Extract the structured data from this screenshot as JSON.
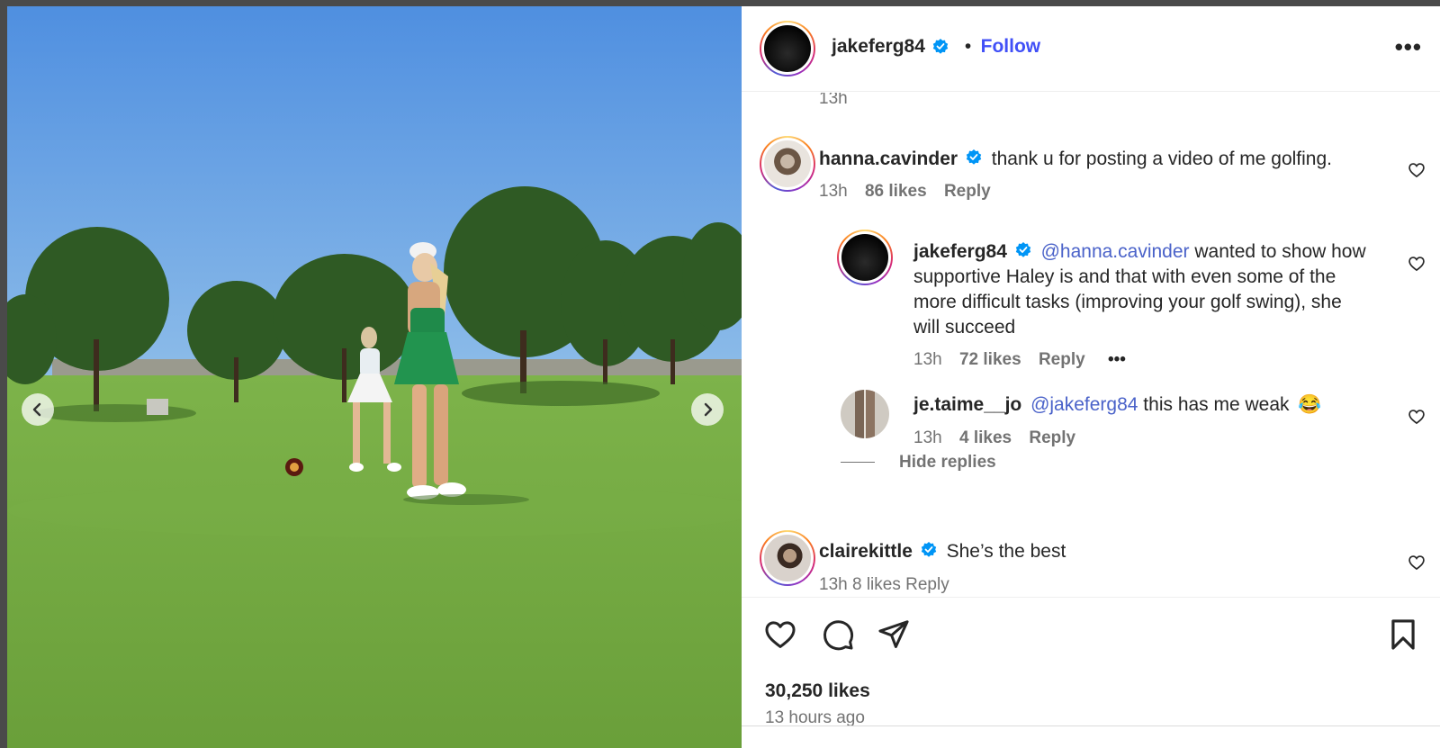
{
  "post": {
    "username": "jakeferg84",
    "follow_label": "Follow",
    "separator": "•",
    "more_label": "•••",
    "top_timestamp": "13h",
    "likes": "30,250 likes",
    "posted_ago": "13 hours ago"
  },
  "comments": [
    {
      "username": "hanna.cavinder",
      "text": "thank u for posting a video of me golfing.",
      "time": "13h",
      "likes": "86 likes",
      "reply_label": "Reply"
    },
    {
      "username": "jakeferg84",
      "mention": "@hanna.cavinder",
      "text_line1": " wanted to show how",
      "text_line2": "supportive Haley is and that with even some of the",
      "text_line3": "more difficult tasks (improving your golf swing), she",
      "text_line4": "will succeed",
      "time": "13h",
      "likes": "72 likes",
      "reply_label": "Reply",
      "more_label": "•••"
    },
    {
      "username": "je.taime__jo",
      "mention": "@jakeferg84",
      "text": " this has me weak",
      "emoji": "😂",
      "time": "13h",
      "likes": "4 likes",
      "reply_label": "Reply"
    },
    {
      "username": "clairekittle",
      "text": "She’s the best",
      "meta_partial": "13h  8 likes  Reply"
    }
  ],
  "hide_replies_label": "Hide replies",
  "colors": {
    "verified_blue": "#0095f6",
    "follow_blue": "#4150f7",
    "mention_blue": "#4a62c9",
    "text": "#262626",
    "muted": "#737373"
  },
  "icons": [
    "verified-badge-icon",
    "more-icon",
    "heart-icon",
    "comment-icon",
    "share-icon",
    "bookmark-icon",
    "chevron-left-icon",
    "chevron-right-icon"
  ]
}
